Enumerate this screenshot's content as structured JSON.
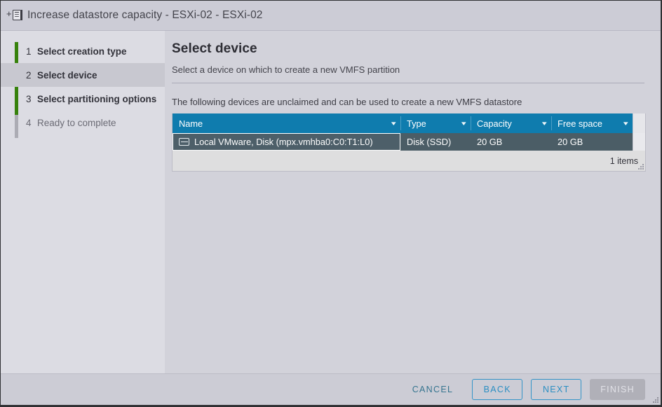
{
  "window": {
    "title": "Increase datastore capacity - ESXi-02 - ESXi-02",
    "icon": "add-document-icon"
  },
  "sidebar": {
    "steps": [
      {
        "num": "1",
        "label": "Select creation type",
        "state": "done"
      },
      {
        "num": "2",
        "label": "Select device",
        "state": "current"
      },
      {
        "num": "3",
        "label": "Select partitioning options",
        "state": "done"
      },
      {
        "num": "4",
        "label": "Ready to complete",
        "state": "todo"
      }
    ],
    "rail_done_color": "#37820c",
    "rail_todo_color": "#acacb4"
  },
  "main": {
    "title": "Select device",
    "subtitle": "Select a device on which to create a new VMFS partition",
    "table_note": "The following devices are unclaimed and can be used to create a new VMFS datastore"
  },
  "table": {
    "accent_color": "#0f7cae",
    "selected_row_color": "#4d5f69",
    "columns": [
      {
        "label": "Name",
        "sort_icon": "chevron-down-icon"
      },
      {
        "label": "Type",
        "sort_icon": "chevron-down-icon"
      },
      {
        "label": "Capacity",
        "sort_icon": "chevron-down-icon"
      },
      {
        "label": "Free space",
        "sort_icon": "chevron-down-icon"
      }
    ],
    "rows": [
      {
        "icon": "disk-icon",
        "name": "Local VMware, Disk (mpx.vmhba0:C0:T1:L0)",
        "type": "Disk (SSD)",
        "capacity": "20 GB",
        "free_space": "20 GB",
        "selected": true
      }
    ],
    "footer_count": "1 items"
  },
  "footer": {
    "cancel_label": "CANCEL",
    "back_label": "BACK",
    "next_label": "NEXT",
    "finish_label": "FINISH",
    "finish_disabled": true
  }
}
